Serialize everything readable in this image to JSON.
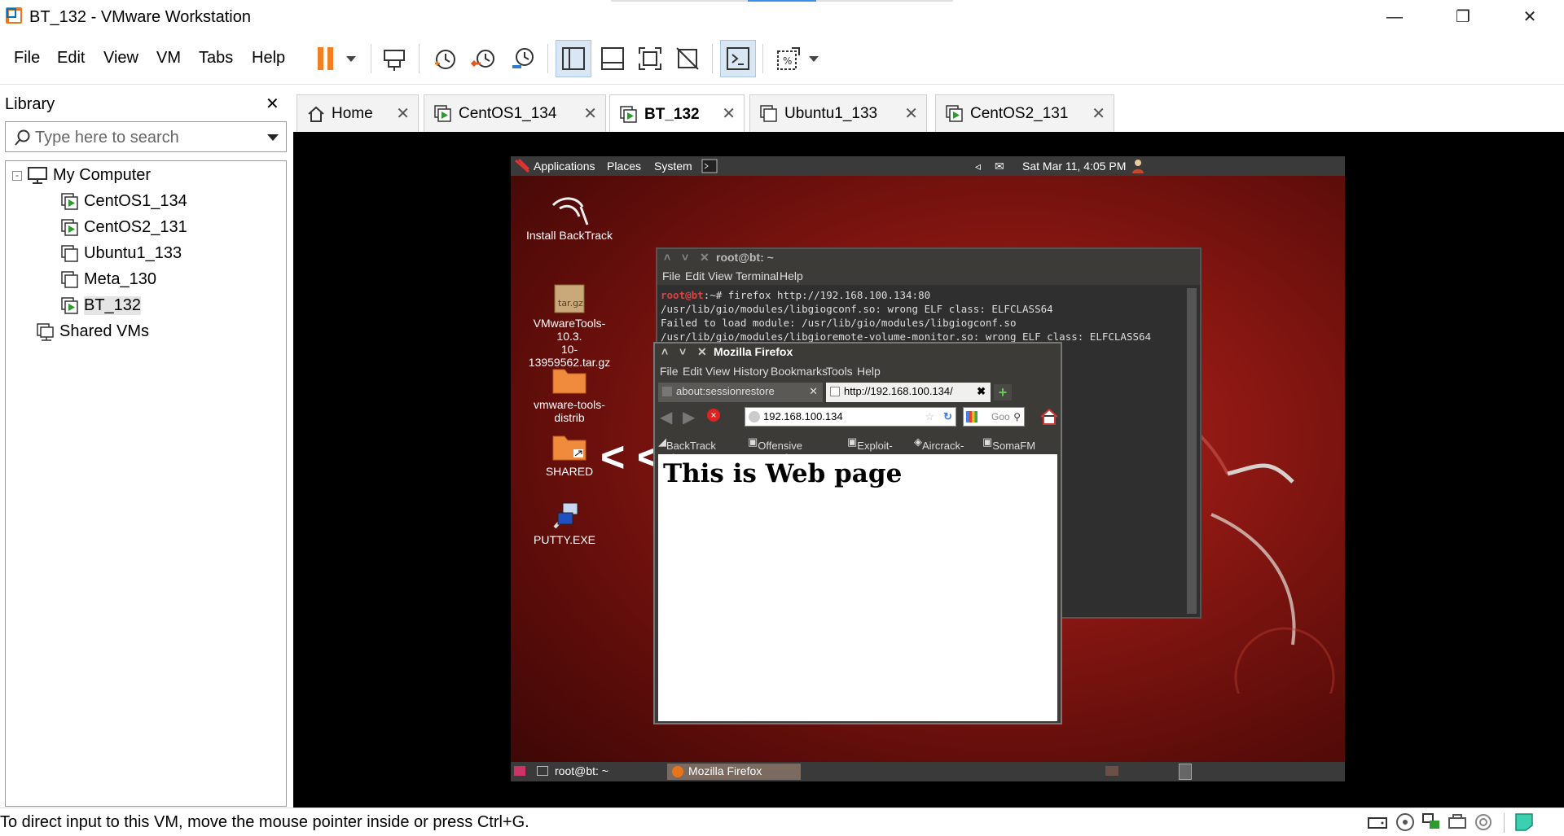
{
  "window": {
    "title": "BT_132 - VMware Workstation"
  },
  "menu": [
    "File",
    "Edit",
    "View",
    "VM",
    "Tabs",
    "Help"
  ],
  "toolbar": {
    "icons": [
      "pause-icon",
      "dropdown-icon",
      "send-ctrl-alt-del-icon",
      "snapshot-icon",
      "revert-snapshot-icon",
      "snapshot-manager-icon",
      "library-view-icon",
      "thumbnail-view-icon",
      "fullscreen-icon",
      "unity-icon",
      "console-icon",
      "stretch-icon"
    ]
  },
  "library": {
    "title": "Library",
    "search_placeholder": "Type here to search",
    "root": "My Computer",
    "vms": [
      "CentOS1_134",
      "CentOS2_131",
      "Ubuntu1_133",
      "Meta_130",
      "BT_132"
    ],
    "shared": "Shared VMs"
  },
  "tabs": [
    {
      "label": "Home",
      "active": false
    },
    {
      "label": "CentOS1_134",
      "active": false
    },
    {
      "label": "BT_132",
      "active": true
    },
    {
      "label": "Ubuntu1_133",
      "active": false
    },
    {
      "label": "CentOS2_131",
      "active": false
    }
  ],
  "guest": {
    "panel": {
      "applications": "Applications",
      "places": "Places",
      "system": "System",
      "clock": "Sat Mar 11,  4:05 PM"
    },
    "desktop_icons": [
      {
        "line1": "Install BackTrack",
        "line2": ""
      },
      {
        "line1": "VMwareTools-10.3.",
        "line2": "10-13959562.tar.gz"
      },
      {
        "line1": "vmware-tools-",
        "line2": "distrib"
      },
      {
        "line1": "SHARED",
        "line2": ""
      },
      {
        "line1": "PUTTY.EXE",
        "line2": ""
      }
    ],
    "taskbar": {
      "terminal": "root@bt: ~",
      "firefox": "Mozilla Firefox"
    },
    "terminal": {
      "title": "root@bt: ~",
      "menu": [
        "File",
        "Edit",
        "View",
        "Terminal",
        "Help"
      ],
      "prompt_user": "root@bt",
      "prompt_rest": ":~# firefox http://192.168.100.134:80",
      "lines": [
        "/usr/lib/gio/modules/libgiogconf.so: wrong ELF class: ELFCLASS64",
        "Failed to load module: /usr/lib/gio/modules/libgiogconf.so",
        "/usr/lib/gio/modules/libgioremote-volume-monitor.so: wrong ELF class: ELFCLASS64"
      ]
    },
    "firefox": {
      "title": "Mozilla Firefox",
      "menu": [
        "File",
        "Edit",
        "View",
        "History",
        "Bookmarks",
        "Tools",
        "Help"
      ],
      "tabs": [
        "about:sessionrestore",
        "http://192.168.100.134/"
      ],
      "url": "192.168.100.134",
      "search_placeholder": "Goo",
      "bookmarks": [
        "BackTrack Linux",
        "Offensive Security",
        "Exploit-DB",
        "Aircrack-ng",
        "SomaFM"
      ],
      "heading": "This is Web page"
    }
  },
  "status": {
    "message": "To direct input to this VM, move the mouse pointer inside or press Ctrl+G."
  },
  "colors": {
    "accent": "#e87722",
    "pause": "#f08020",
    "guest_bg": "#8a1712",
    "panel": "#3a3a3a"
  }
}
